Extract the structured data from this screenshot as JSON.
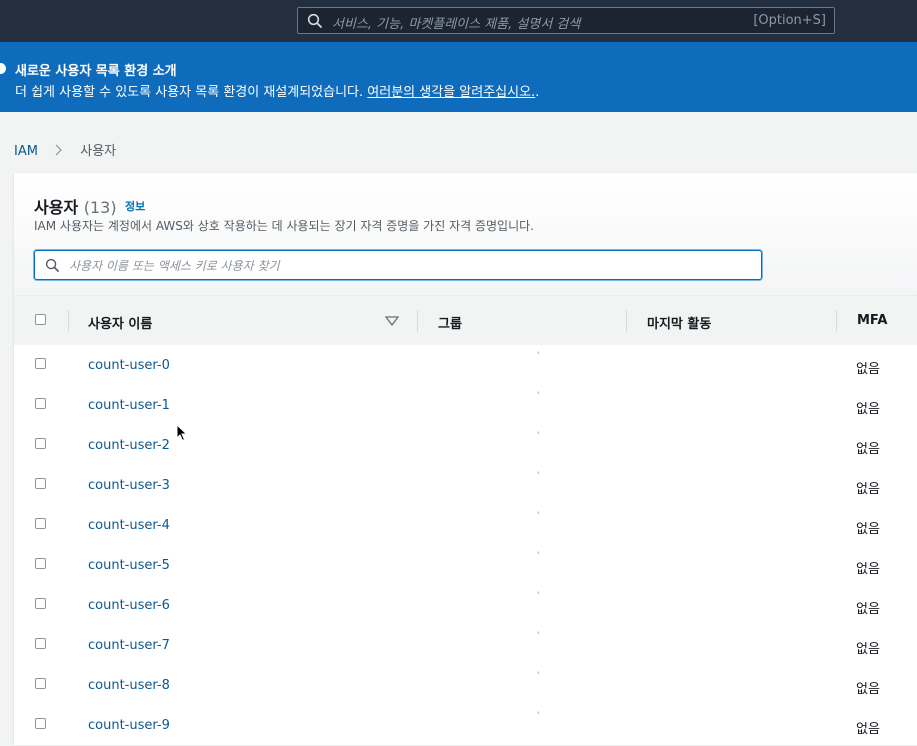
{
  "topbar": {
    "search_placeholder": "서비스, 기능, 마켓플레이스 제품, 설명서 검색",
    "shortcut": "[Option+S]"
  },
  "banner": {
    "title": "새로운 사용자 목록 환경 소개",
    "message": "더 쉽게 사용할 수 있도록 사용자 목록 환경이 재설계되었습니다. ",
    "link": "여러분의 생각을 알려주십시오.",
    "trailing": "."
  },
  "breadcrumb": {
    "root": "IAM",
    "current": "사용자"
  },
  "panel": {
    "title": "사용자",
    "count": "(13)",
    "info": "정보",
    "description": "IAM 사용자는 계정에서 AWS와 상호 작용하는 데 사용되는 장기 자격 증명을 가진 자격 증명입니다.",
    "filter_placeholder": "사용자 이름 또는 액세스 키로 사용자 찾기"
  },
  "table": {
    "columns": {
      "username": "사용자 이름",
      "groups": "그룹",
      "last_activity": "마지막 활동",
      "mfa": "MFA"
    },
    "rows": [
      {
        "name": "count-user-0",
        "group": "'",
        "activity": "",
        "mfa": "없음"
      },
      {
        "name": "count-user-1",
        "group": "'",
        "activity": "",
        "mfa": "없음"
      },
      {
        "name": "count-user-2",
        "group": "'",
        "activity": "",
        "mfa": "없음"
      },
      {
        "name": "count-user-3",
        "group": "'",
        "activity": "",
        "mfa": "없음"
      },
      {
        "name": "count-user-4",
        "group": "'",
        "activity": "",
        "mfa": "없음"
      },
      {
        "name": "count-user-5",
        "group": "'",
        "activity": "",
        "mfa": "없음"
      },
      {
        "name": "count-user-6",
        "group": "'",
        "activity": "",
        "mfa": "없음"
      },
      {
        "name": "count-user-7",
        "group": "'",
        "activity": "",
        "mfa": "없음"
      },
      {
        "name": "count-user-8",
        "group": "'",
        "activity": "",
        "mfa": "없음"
      },
      {
        "name": "count-user-9",
        "group": "'",
        "activity": "",
        "mfa": "없음"
      }
    ]
  }
}
